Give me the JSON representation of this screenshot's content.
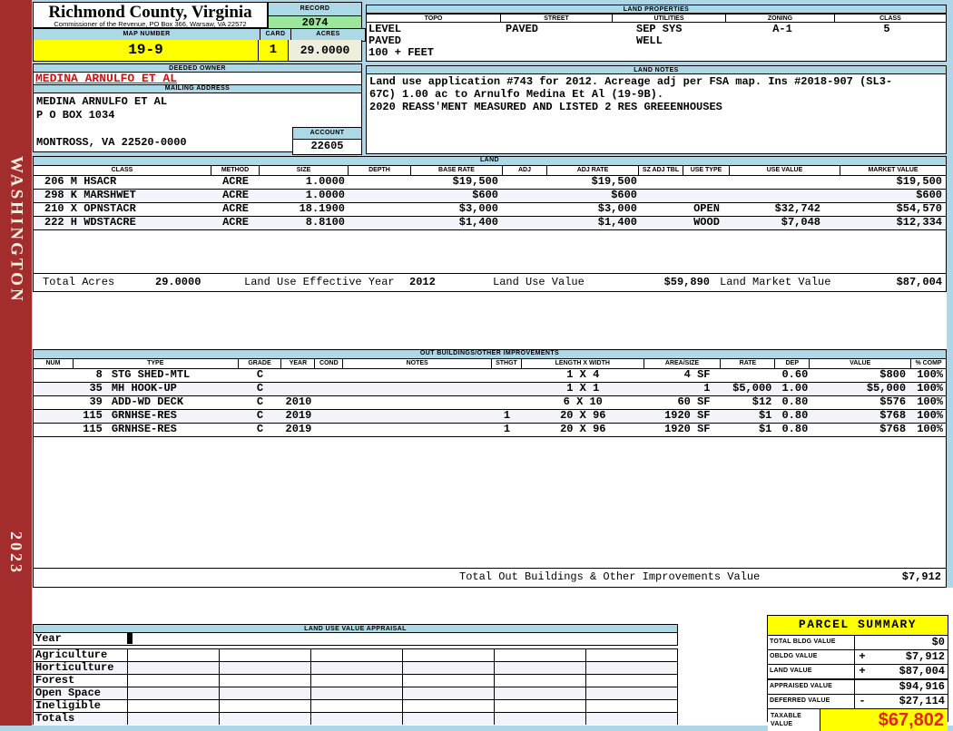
{
  "header": {
    "county_title": "Richmond County, Virginia",
    "commissioner_line": "Commissioner of the Revenue, PO Box 366, Warsaw, VA 22572",
    "record_label": "RECORD",
    "record_value": "2074",
    "map_number_label": "MAP NUMBER",
    "map_number_value": "19-9",
    "card_label": "CARD",
    "card_value": "1",
    "acres_label": "ACRES",
    "acres_value": "29.0000"
  },
  "sidebar": {
    "district": "WASHINGTON",
    "year": "2023"
  },
  "land_properties": {
    "title": "LAND PROPERTIES",
    "columns": [
      "TOPO",
      "STREET",
      "UTILITIES",
      "ZONING",
      "CLASS"
    ],
    "topo_values": [
      "LEVEL",
      "PAVED",
      "100 + FEET"
    ],
    "street_values": [
      "PAVED"
    ],
    "utilities_values": [
      "SEP SYS",
      "WELL"
    ],
    "zoning_values": [
      "A-1"
    ],
    "class_values": [
      "5"
    ]
  },
  "owner": {
    "deeded_owner_label": "DEEDED OWNER",
    "deeded_owner": "MEDINA ARNULFO ET AL",
    "mailing_address_label": "MAILING ADDRESS",
    "mailing_lines": [
      "MEDINA ARNULFO ET AL",
      "P O BOX 1034",
      "",
      "MONTROSS, VA 22520-0000"
    ],
    "account_label": "ACCOUNT",
    "account_value": "22605"
  },
  "land_notes": {
    "title": "LAND NOTES",
    "lines": [
      "Land use application #743 for 2012. Acreage adj per FSA map. Ins #2018-907 (SL3-",
      "67C) 1.00 ac to Arnulfo Medina Et Al (19-9B).",
      "2020 REASS'MENT MEASURED AND LISTED 2 RES GREEENHOUSES"
    ]
  },
  "land_table": {
    "title": "LAND",
    "columns": [
      "CLASS",
      "METHOD",
      "SIZE",
      "DEPTH",
      "BASE RATE",
      "ADJ",
      "ADJ RATE",
      "SZ ADJ TBL",
      "USE TYPE",
      "USE VALUE",
      "MARKET VALUE"
    ],
    "rows": [
      [
        "206 M HSACR",
        "ACRE",
        "1.0000",
        "",
        "$19,500",
        "",
        "$19,500",
        "",
        "",
        "",
        "$19,500"
      ],
      [
        "298 K MARSHWET",
        "ACRE",
        "1.0000",
        "",
        "$600",
        "",
        "$600",
        "",
        "",
        "",
        "$600"
      ],
      [
        "210 X OPNSTACR",
        "ACRE",
        "18.1900",
        "",
        "$3,000",
        "",
        "$3,000",
        "",
        "OPEN",
        "$32,742",
        "$54,570"
      ],
      [
        "222 H WDSTACRE",
        "ACRE",
        "8.8100",
        "",
        "$1,400",
        "",
        "$1,400",
        "",
        "WOOD",
        "$7,048",
        "$12,334"
      ]
    ],
    "totals": {
      "total_acres_label": "Total Acres",
      "total_acres": "29.0000",
      "effective_year_label": "Land Use Effective Year",
      "effective_year": "2012",
      "use_value_label": "Land Use Value",
      "use_value": "$59,890",
      "market_value_label": "Land Market Value",
      "market_value": "$87,004"
    }
  },
  "out_buildings": {
    "title": "OUT BUILDINGS/OTHER IMPROVEMENTS",
    "columns": [
      "NUM",
      "TYPE",
      "GRADE",
      "YEAR",
      "COND",
      "NOTES",
      "STHGT",
      "LENGTH X WIDTH",
      "AREA/SIZE",
      "RATE",
      "DEP",
      "VALUE",
      "% COMP"
    ],
    "rows": [
      [
        "8",
        "STG SHED-MTL",
        "C",
        "",
        "",
        "",
        "",
        "1 X 4",
        "4 SF",
        "",
        "0.60",
        "$800",
        "100%"
      ],
      [
        "35",
        "MH HOOK-UP",
        "C",
        "",
        "",
        "",
        "",
        "1 X 1",
        "1",
        "$5,000",
        "1.00",
        "$5,000",
        "100%"
      ],
      [
        "39",
        "ADD-WD DECK",
        "C",
        "2010",
        "",
        "",
        "",
        "6 X 10",
        "60 SF",
        "$12",
        "0.80",
        "$576",
        "100%"
      ],
      [
        "115",
        "GRNHSE-RES",
        "C",
        "2019",
        "",
        "",
        "1",
        "20 X 96",
        "1920 SF",
        "$1",
        "0.80",
        "$768",
        "100%"
      ],
      [
        "115",
        "GRNHSE-RES",
        "C",
        "2019",
        "",
        "",
        "1",
        "20 X 96",
        "1920 SF",
        "$1",
        "0.80",
        "$768",
        "100%"
      ]
    ],
    "total_label": "Total Out Buildings & Other Improvements Value",
    "total_value": "$7,912"
  },
  "land_use_appraisal": {
    "title": "LAND USE VALUE APPRAISAL",
    "row_labels": [
      "Year",
      "Agriculture",
      "Horticulture",
      "Forest",
      "Open Space",
      "Ineligible",
      "Totals"
    ],
    "num_columns": 6
  },
  "parcel_summary": {
    "title": "PARCEL SUMMARY",
    "rows": [
      {
        "label": "TOTAL BLDG VALUE",
        "op": "",
        "value": "$0"
      },
      {
        "label": "OBLDG VALUE",
        "op": "+",
        "value": "$7,912"
      },
      {
        "label": "LAND VALUE",
        "op": "+",
        "value": "$87,004"
      },
      {
        "label": "APPRAISED VALUE",
        "op": "",
        "value": "$94,916"
      },
      {
        "label": "DEFERRED VALUE",
        "op": "-",
        "value": "$27,114"
      }
    ],
    "taxable_label_lines": [
      "TAXABLE",
      "VALUE"
    ],
    "taxable_value": "$67,802"
  },
  "colors": {
    "header_blue": "#ADD8E6",
    "highlight_yellow": "#FFFF00",
    "record_green": "#9CE69C",
    "acres_cream": "#EFEEDD",
    "sidebar_red": "#A32C2C",
    "owner_red": "#CC1111",
    "taxable_red": "#E4251B"
  }
}
